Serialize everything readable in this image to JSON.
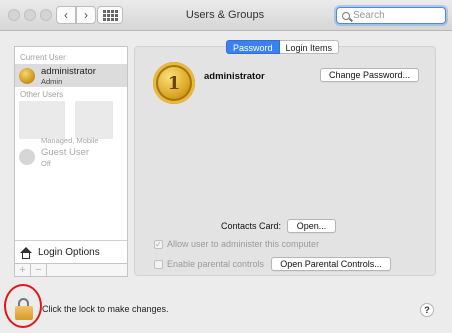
{
  "window": {
    "title": "Users & Groups"
  },
  "search": {
    "placeholder": "Search"
  },
  "sidebar": {
    "current_user_label": "Current User",
    "current_user": {
      "name": "administrator",
      "role": "Admin"
    },
    "other_users_label": "Other Users",
    "other_users": [
      {
        "name": "",
        "role": "Managed, Mobile"
      },
      {
        "name": "Guest User",
        "role": "Off"
      }
    ],
    "login_options": "Login Options",
    "add_symbol": "+",
    "remove_symbol": "−"
  },
  "tabs": [
    {
      "label": "Password",
      "active": true
    },
    {
      "label": "Login Items",
      "active": false
    }
  ],
  "main": {
    "username": "administrator",
    "avatar_glyph": "1",
    "change_password": "Change Password...",
    "contacts_card_label": "Contacts Card:",
    "open_button": "Open...",
    "allow_admin": {
      "label": "Allow user to administer this computer",
      "checked": true
    },
    "parental_controls": {
      "label": "Enable parental controls",
      "checked": false
    },
    "open_parental_button": "Open Parental Controls..."
  },
  "footer": {
    "lock_text": "Click the lock to make changes.",
    "help": "?"
  },
  "colors": {
    "accent": "#3b82f0",
    "highlight_circle": "#e01818",
    "lock": "#e0a84a"
  }
}
